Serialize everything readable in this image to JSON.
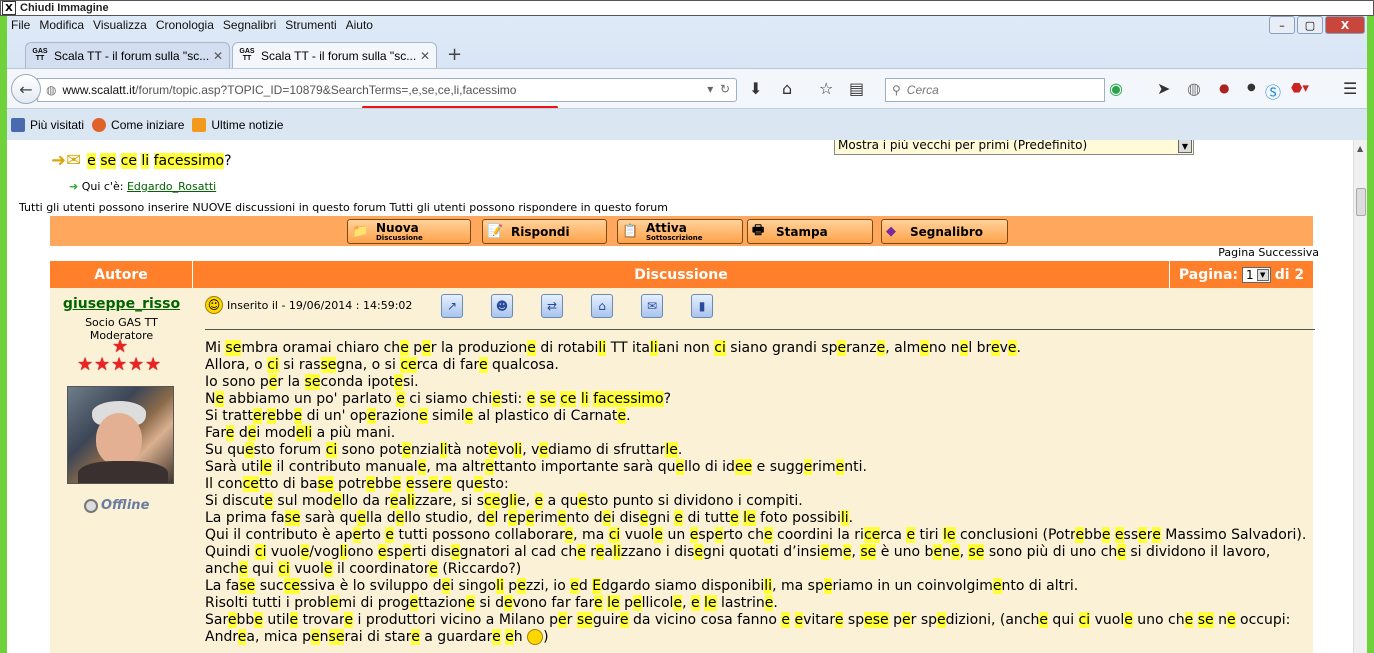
{
  "titlebar": {
    "close_glyph": "X",
    "title": "Chiudi Immagine"
  },
  "menu": [
    "File",
    "Modifica",
    "Visualizza",
    "Cronologia",
    "Segnalibri",
    "Strumenti",
    "Aiuto"
  ],
  "window_buttons": {
    "minimize": "–",
    "maximize": "▢",
    "close": "X"
  },
  "tabs": [
    {
      "favicon": "GAS TT",
      "label": "Scala TT - il forum sulla \"sc...",
      "active": false
    },
    {
      "favicon": "GAS TT",
      "label": "Scala TT - il forum sulla \"sc...",
      "active": true
    }
  ],
  "new_tab_glyph": "+",
  "address": {
    "host": "www.scalatt.it",
    "path": "/forum/topic.asp?TOPIC_ID=10879&SearchTerms=,e,se,ce,li,facessimo"
  },
  "search": {
    "placeholder": "Cerca"
  },
  "bookmarks": [
    "Più visitati",
    "Come iniziare",
    "Ultime notizie"
  ],
  "forum": {
    "sort_select": "Mostra i più vecchi per primi (Predefinito)",
    "topic_title_words": [
      "e",
      "se",
      "ce",
      "li",
      "facessimo"
    ],
    "topic_title_suffix": "?",
    "present_label": "Qui c'è:",
    "present_user": "Edgardo_Rosatti",
    "permissions": "Tutti gli utenti possono inserire NUOVE discussioni in questo forum Tutti gli utenti possono rispondere in questo forum",
    "buttons": [
      {
        "label": "Nuova",
        "sub": "Discussione",
        "icon": "new-topic-icon"
      },
      {
        "label": "Rispondi",
        "sub": "",
        "icon": "reply-icon"
      },
      {
        "label": "Attiva",
        "sub": "Sottoscrizione",
        "icon": "subscribe-icon"
      },
      {
        "label": "Stampa",
        "sub": "",
        "icon": "print-icon"
      },
      {
        "label": "Segnalibro",
        "sub": "",
        "icon": "bookmark-icon"
      }
    ],
    "next_page": "Pagina Successiva",
    "header": {
      "author": "Autore",
      "discussion": "Discussione",
      "page_label": "Pagina:",
      "page_value": "1",
      "page_total": "di 2"
    },
    "post": {
      "author": "giuseppe_risso",
      "role1": "Socio GAS TT",
      "role2": "Moderatore",
      "status": "Offline",
      "posted": "Inserito il - 19/06/2014 : 14:59:02"
    }
  }
}
